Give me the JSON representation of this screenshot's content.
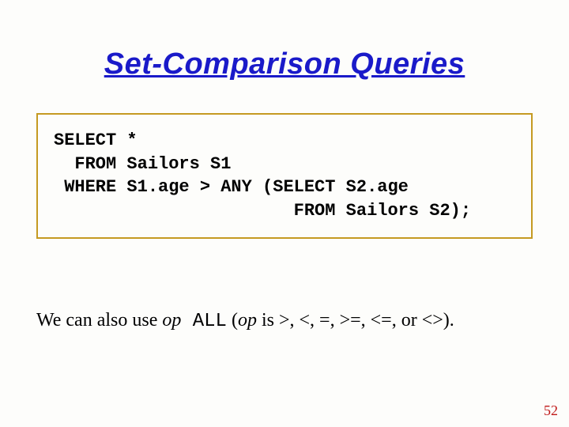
{
  "title": "Set-Comparison Queries",
  "code": {
    "line1": "SELECT *",
    "line2": "  FROM Sailors S1",
    "line3": " WHERE S1.age > ANY (SELECT S2.age",
    "line4": "                       FROM Sailors S2);"
  },
  "body": {
    "part1": "We can also use ",
    "op1": "op",
    "all": " ALL",
    "part2": " (",
    "op2": "op",
    "part3": " is >, <, =, >=, <=, or <>)."
  },
  "page_number": "52"
}
